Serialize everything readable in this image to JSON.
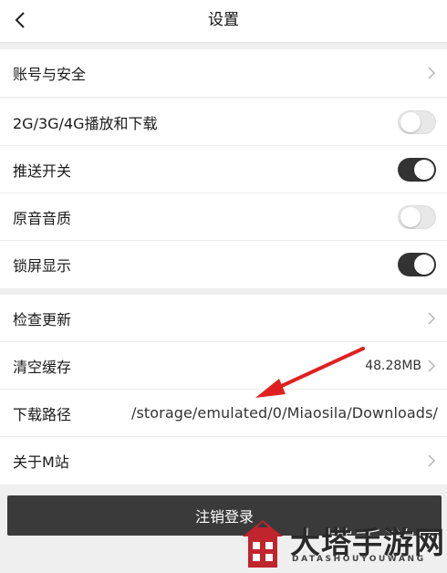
{
  "header": {
    "title": "设置"
  },
  "groups": [
    {
      "items": [
        {
          "label": "账号与安全"
        }
      ]
    },
    {
      "items": [
        {
          "label": "2G/3G/4G播放和下载",
          "toggle": "off"
        },
        {
          "label": "推送开关",
          "toggle": "on"
        },
        {
          "label": "原音音质",
          "toggle": "off"
        },
        {
          "label": "锁屏显示",
          "toggle": "on"
        }
      ]
    },
    {
      "items": [
        {
          "label": "检查更新"
        },
        {
          "label": "清空缓存",
          "value": "48.28MB"
        },
        {
          "label": "下载路径",
          "value": "/storage/emulated/0/Miaosila/Downloads/"
        },
        {
          "label": "关于M站"
        }
      ]
    }
  ],
  "logout": {
    "label": "注销登录"
  },
  "watermark": {
    "text": "大塔手游网",
    "subtext": "DATASHOUYOUWANG"
  },
  "colors": {
    "toggle_on": "#333333",
    "toggle_off": "#e8e8e8",
    "annotation_arrow": "#e02020",
    "watermark_red": "#c0242c"
  }
}
